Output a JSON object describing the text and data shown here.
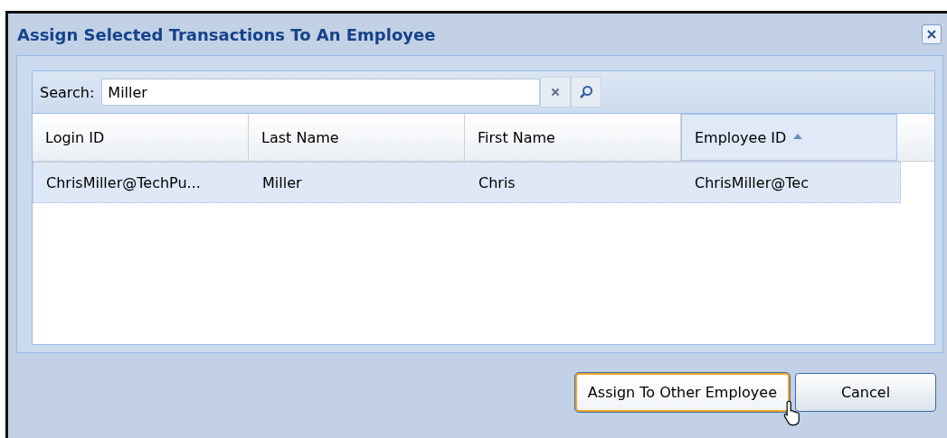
{
  "window": {
    "title": "Assign Selected Transactions To An Employee"
  },
  "search": {
    "label": "Search:",
    "value": "Miller"
  },
  "table": {
    "columns": [
      {
        "label": "Login ID",
        "sorted": false
      },
      {
        "label": "Last Name",
        "sorted": false
      },
      {
        "label": "First Name",
        "sorted": false
      },
      {
        "label": "Employee ID",
        "sorted": true
      }
    ],
    "rows": [
      {
        "selected": true,
        "cells": [
          "ChrisMiller@TechPu...",
          "Miller",
          "Chris",
          "ChrisMiller@Tec"
        ]
      }
    ]
  },
  "buttons": [
    {
      "label": "Assign To Other Employee",
      "hover": true
    },
    {
      "label": "Cancel",
      "hover": false
    }
  ]
}
